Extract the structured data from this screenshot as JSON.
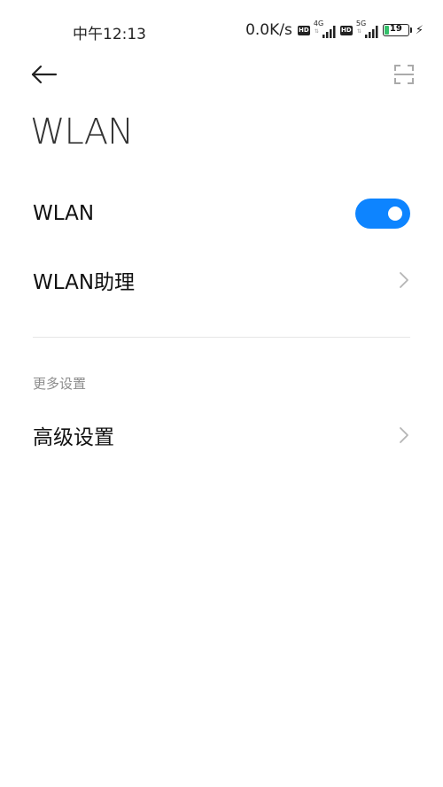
{
  "status_bar": {
    "time": "中午12:13",
    "net_speed": "0.0K/s",
    "hd_badge": "HD",
    "sim1_generation": "4G",
    "sim2_generation": "5G",
    "battery_level": "19",
    "battery_fraction": 0.19,
    "battery_color": "#35c06b"
  },
  "header": {
    "back_icon": "arrow-left-icon",
    "scan_icon": "scan-frame-icon"
  },
  "page_title": "WLAN",
  "settings": {
    "wlan_toggle": {
      "label": "WLAN",
      "enabled": true,
      "accent_color": "#0d84ff"
    },
    "wlan_assistant": {
      "label": "WLAN助理"
    },
    "more_section_header": "更多设置",
    "advanced": {
      "label": "高级设置"
    }
  }
}
